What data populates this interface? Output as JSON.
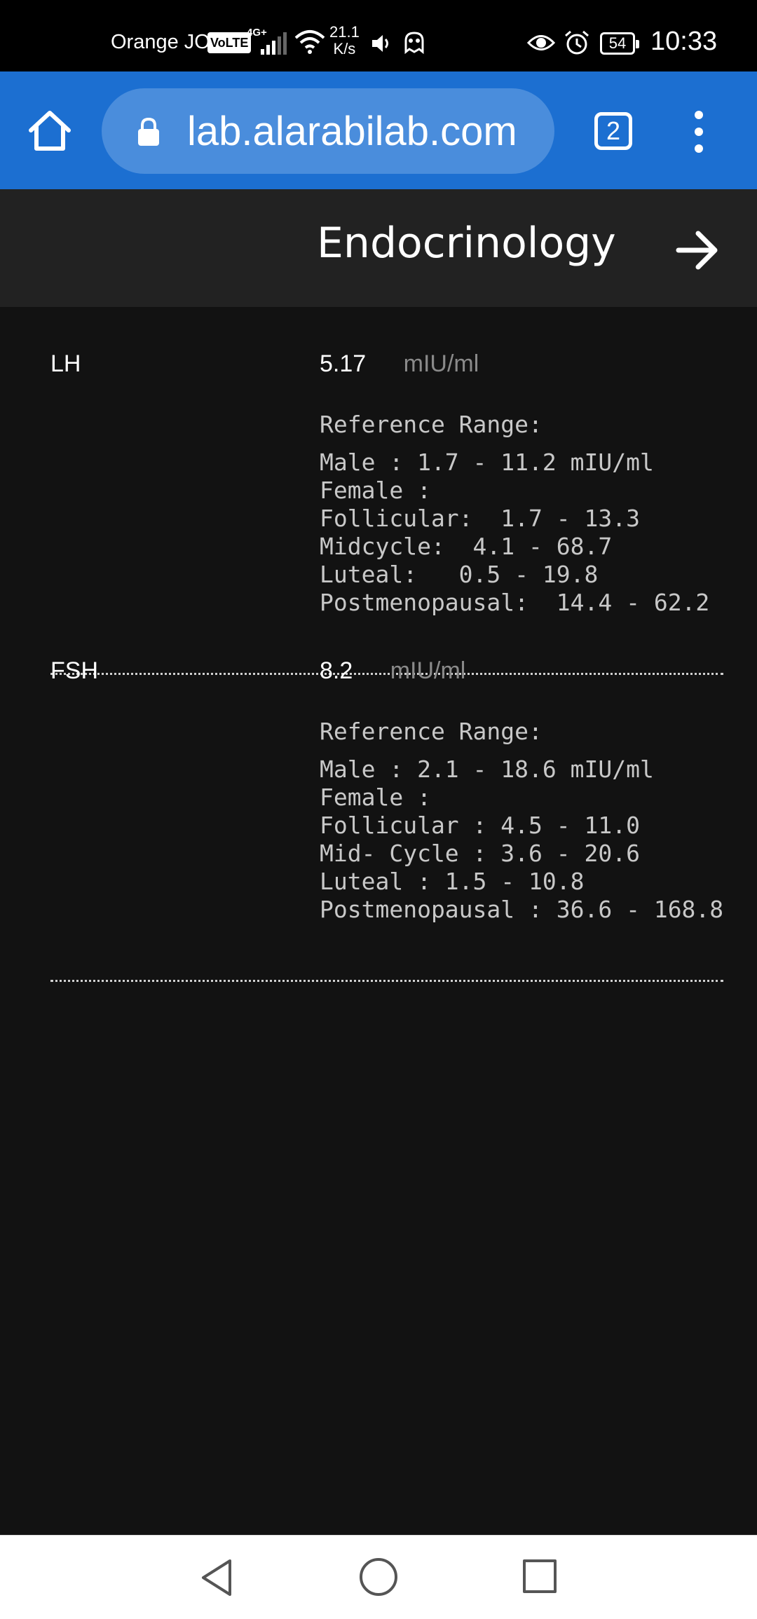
{
  "status_bar": {
    "carrier": "Orange JO",
    "volte_badge": "VoLTE",
    "network_type": "4G+",
    "speed_value": "21.1",
    "speed_unit": "K/s",
    "battery": "54",
    "time": "10:33",
    "icons": [
      "volte-icon",
      "signal-icon",
      "wifi-icon",
      "sound-icon",
      "ghost-icon",
      "eye-icon",
      "alarm-icon",
      "battery-icon"
    ]
  },
  "browser": {
    "url": "lab.alarabilab.com",
    "tab_count": "2",
    "icons": [
      "home-icon",
      "lock-icon",
      "tabs-icon",
      "more-vert-icon"
    ]
  },
  "header": {
    "title": "Endocrinology",
    "next_icon": "arrow-right-icon"
  },
  "tests": [
    {
      "name": "LH",
      "value": "5.17",
      "unit": "mIU/ml",
      "ref_title": "Reference Range:",
      "ref_lines": "Male : 1.7 - 11.2 mIU/ml\nFemale :\nFollicular:  1.7 - 13.3\nMidcycle:  4.1 - 68.7\nLuteal:   0.5 - 19.8\nPostmenopausal:  14.4 - 62.2"
    },
    {
      "name": "FSH",
      "value": "8.2",
      "unit": "mIU/ml",
      "ref_title": "Reference Range:",
      "ref_lines": "Male : 2.1 - 18.6 mIU/ml\nFemale :\nFollicular : 4.5 - 11.0\nMid- Cycle : 3.6 - 20.6\nLuteal : 1.5 - 10.8\nPostmenopausal : 36.6 - 168.8"
    }
  ],
  "nav_bar": {
    "icons": [
      "back-icon",
      "home-circle-icon",
      "recents-icon"
    ]
  },
  "colors": {
    "browser_bar": "#1c6fd1",
    "url_pill": "#4a8ddc",
    "header_bg": "#222222",
    "page_bg": "#121212"
  }
}
